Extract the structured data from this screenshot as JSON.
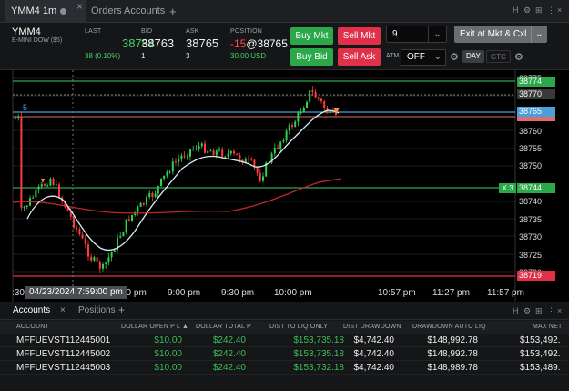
{
  "tabs": {
    "active_label": "YMM4 1m",
    "items": [
      "Orders",
      "Accounts"
    ],
    "add": "+",
    "close": "×"
  },
  "window_controls": [
    "H",
    "⚙",
    "⊞",
    "⋮",
    "×"
  ],
  "quote": {
    "symbol": "YMM4",
    "description": "E-MINI DOW ($5)",
    "last_label": "LAST",
    "last_value": "38764",
    "last_change": "38 (0.10%)",
    "bid_label": "BID",
    "bid_value": "38763",
    "bid_size": "1",
    "ask_label": "ASK",
    "ask_value": "38765",
    "ask_size": "3",
    "position_label": "POSITION",
    "position_qty": "-15",
    "position_price": "@38765",
    "position_pnl": "30.00 USD",
    "buy_mkt": "Buy Mkt",
    "sell_mkt": "Sell Mkt",
    "buy_bid": "Buy Bid",
    "sell_ask": "Sell Ask",
    "qty_value": "9",
    "exit_label": "Exit at Mkt & Cxl",
    "atm_label": "ATM",
    "atm_value": "OFF",
    "day_label": "DAY",
    "gtc_label": "GTC"
  },
  "chart_data": {
    "type": "candlestick",
    "price_labels": [
      "38775",
      "38770",
      "38765",
      "38760",
      "38755",
      "38750",
      "38745",
      "38740",
      "38735",
      "38730",
      "38725",
      "38720"
    ],
    "tags": {
      "top_green": "38774",
      "gray": "38770",
      "blue": "38765",
      "green_mid": "38744",
      "red_bottom": "38719",
      "position_qty_tag": "3",
      "position_marker": "X"
    },
    "position_line_label": "-5",
    "time_labels": [
      ":30",
      "30 pm",
      "9:00 pm",
      "9:30 pm",
      "10:00 pm",
      "10:57 pm",
      "11:27 pm",
      "11:57 pm"
    ],
    "crosshair_time": "04/23/2024 7:59:00 pm",
    "colors": {
      "up": "#2fd14f",
      "down": "#ff3b3b",
      "sma_fast": "#d7ecf5",
      "sma_slow": "#c02828",
      "accent_blue": "#4a9fd8"
    }
  },
  "bottom": {
    "tabs": [
      "Accounts",
      "Positions"
    ],
    "add": "+",
    "columns": [
      "ACCOUNT",
      "DOLLAR OPEN P L ▲",
      "DOLLAR TOTAL P",
      "DIST TO LIQ ONLY",
      "DIST DRAWDOWN",
      "DRAWDOWN AUTO LIQ",
      "MAX NET"
    ],
    "rows": [
      {
        "account": "MFFUEVST112445001",
        "open_pl": "$10.00",
        "total_pl": "$242.40",
        "dist_liq": "$153,735.18",
        "dist_dd": "$4,742.40",
        "dd_auto": "$148,992.78",
        "max_net": "$153,492."
      },
      {
        "account": "MFFUEVST112445002",
        "open_pl": "$10.00",
        "total_pl": "$242.40",
        "dist_liq": "$153,735.18",
        "dist_dd": "$4,742.40",
        "dd_auto": "$148,992.78",
        "max_net": "$153,492."
      },
      {
        "account": "MFFUEVST112445003",
        "open_pl": "$10.00",
        "total_pl": "$242.40",
        "dist_liq": "$153,732.18",
        "dist_dd": "$4,742.40",
        "dd_auto": "$148,989.78",
        "max_net": "$153,489."
      }
    ]
  }
}
